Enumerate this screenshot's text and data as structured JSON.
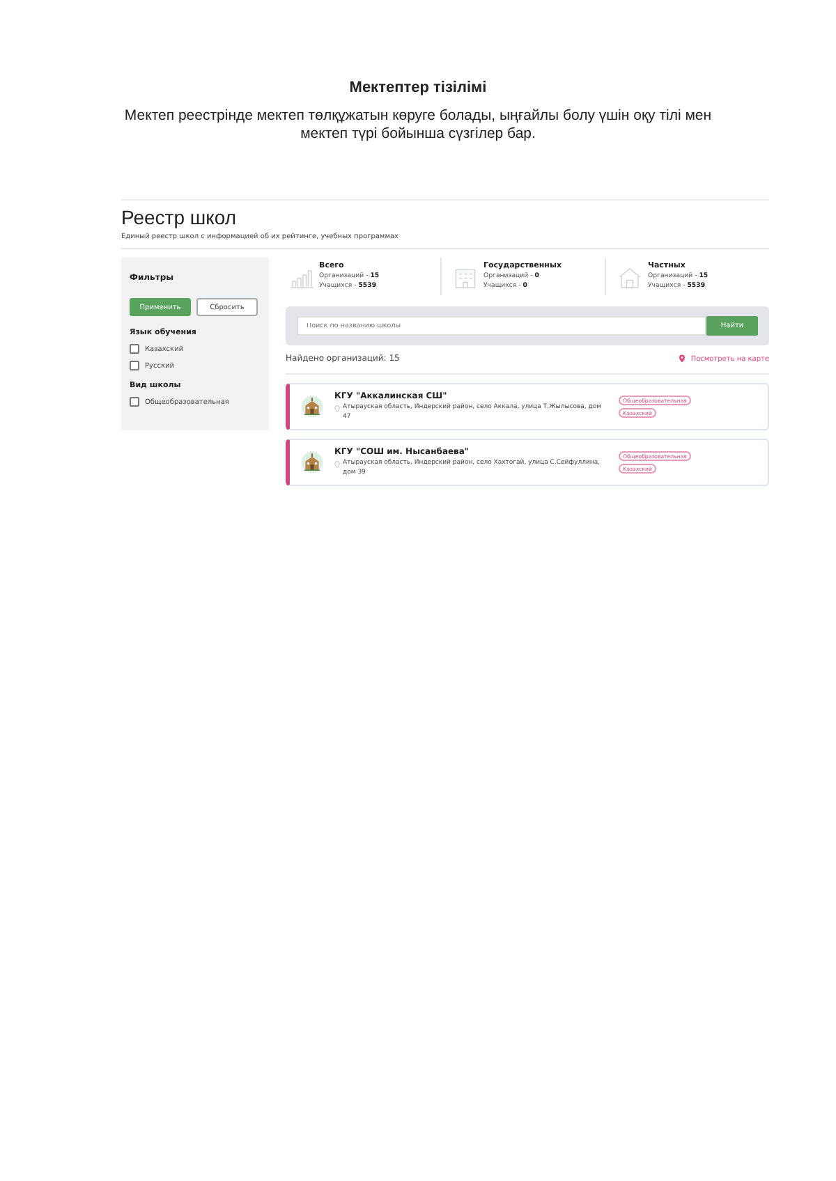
{
  "document": {
    "title": "Мектептер тізілімі",
    "text": "Мектеп реестрінде мектеп төлқұжатын көруге болады, ыңғайлы болу үшін оқу тілі мен мектеп түрі бойынша сүзгілер бар."
  },
  "screen": {
    "title": "Реестр школ",
    "subtitle": "Единый реестр школ с информацией об их рейтинге, учебных программах",
    "filters": {
      "title": "Фильтры",
      "apply": "Применить",
      "reset": "Сбросить",
      "groups": [
        {
          "title": "Язык обучения",
          "options": [
            {
              "label": "Казахский",
              "checked": false
            },
            {
              "label": "Русский",
              "checked": false
            }
          ]
        },
        {
          "title": "Вид школы",
          "options": [
            {
              "label": "Общеобразовательная",
              "checked": false
            }
          ]
        }
      ]
    },
    "stats": [
      {
        "kind": "chart",
        "title": "Всего",
        "orgs_label": "Организаций - ",
        "orgs": "15",
        "students_label": "Учащихся - ",
        "students": "5539"
      },
      {
        "kind": "building",
        "title": "Государственных",
        "orgs_label": "Организаций - ",
        "orgs": "0",
        "students_label": "Учащихся - ",
        "students": "0"
      },
      {
        "kind": "school",
        "title": "Частных",
        "orgs_label": "Организаций - ",
        "orgs": "15",
        "students_label": "Учащихся - ",
        "students": "5539"
      }
    ],
    "search": {
      "placeholder": "Поиск по названию школы",
      "button": "Найти"
    },
    "found": "Найдено организаций: 15",
    "map_link": "Посмотреть на карте",
    "schools": [
      {
        "name": "КГУ \"Аккалинская СШ\"",
        "address": "Атырауская область, Индерский район, село Аккала, улица Т.Жылысова, дом 47",
        "tags": [
          "Общеобразовательная",
          "Казахский"
        ]
      },
      {
        "name": "КГУ \"СОШ им. Нысанбаева\"",
        "address": "Атырауская область, Индерский район, село Хахтогай, улица С.Сейфуллина, дом 39",
        "tags": [
          "Общеобразовательная",
          "Казахский"
        ]
      }
    ]
  }
}
